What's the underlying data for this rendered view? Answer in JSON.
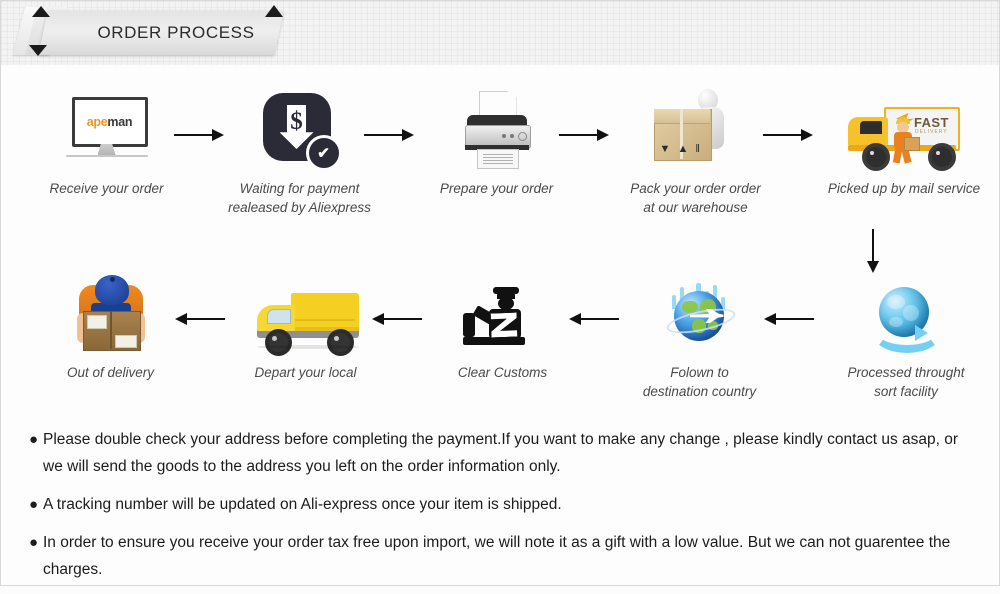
{
  "header": {
    "title": "ORDER PROCESS"
  },
  "steps_row1": [
    {
      "icon": "monitor-apeman-icon",
      "logo_part1": "ape",
      "logo_part2": "man",
      "caption": "Receive your order"
    },
    {
      "icon": "payment-dollar-arrow-check-icon",
      "dollar": "$",
      "check": "✔",
      "caption": "Waiting for payment\nrealeased by Aliexpress"
    },
    {
      "icon": "printer-icon",
      "caption": "Prepare your order"
    },
    {
      "icon": "worker-packing-box-icon",
      "box_mark": "▼ ▲ ‖",
      "caption": "Pack your order order\nat our warehouse"
    },
    {
      "icon": "fast-delivery-truck-icon",
      "truck_text": "FAST",
      "truck_subtext": "DELIVERY",
      "caption": "Picked up by mail service"
    }
  ],
  "steps_row2": [
    {
      "icon": "delivery-person-box-icon",
      "caption": "Out of delivery"
    },
    {
      "icon": "yellow-van-icon",
      "caption": "Depart your local"
    },
    {
      "icon": "customs-officer-icon",
      "caption": "Clear Customs"
    },
    {
      "icon": "globe-airplane-icon",
      "caption": "Folown to\ndestination country"
    },
    {
      "icon": "globe-sort-arrow-icon",
      "caption": "Processed throught\nsort facility"
    }
  ],
  "arrows": {
    "right_icon": "arrow-right-icon",
    "left_icon": "arrow-left-icon",
    "down_icon": "arrow-down-icon"
  },
  "notes": {
    "bullet_glyph": "●",
    "items": [
      "Please double check your address before completing the payment.If you want to make any change , please kindly contact us asap, or we will send the goods to the address you left on the order information only.",
      "A tracking number will be updated on Ali-express once your item is shipped.",
      "In order to ensure you receive your order tax free upon import, we will note it as a gift with a low value. But we can not guarentee the charges."
    ]
  },
  "colors": {
    "accent_orange": "#e8962b",
    "truck_yellow": "#f7c12c",
    "van_yellow": "#f5d022",
    "payment_dark": "#2b2b38",
    "globe_blue": "#2a9bd4",
    "text_dark": "#1c1c1c",
    "caption_gray": "#4a4a4a"
  }
}
